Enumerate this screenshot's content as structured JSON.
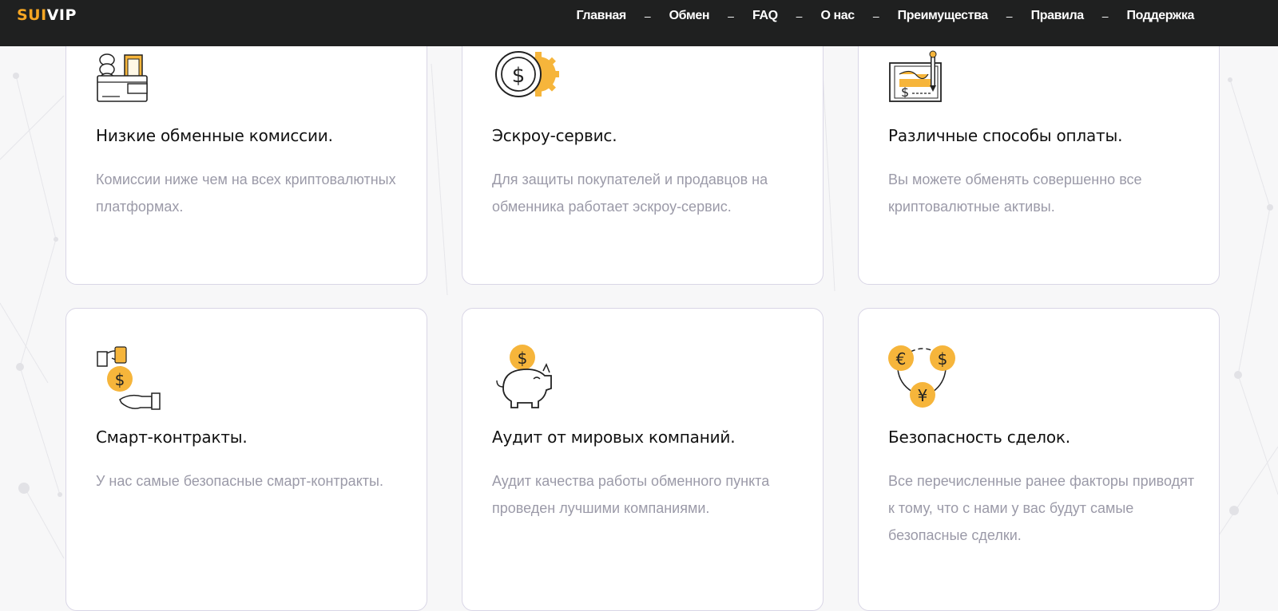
{
  "brand": {
    "logo_part1": "SUI",
    "logo_part2": "VIP",
    "accent_color": "#f6a623",
    "header_color": "#1f2020"
  },
  "nav": {
    "separator": "–",
    "items": [
      {
        "label": "Главная"
      },
      {
        "label": "Обмен"
      },
      {
        "label": "FAQ"
      },
      {
        "label": "О нас"
      },
      {
        "label": "Преимущества"
      },
      {
        "label": "Правила"
      },
      {
        "label": "Поддержка"
      }
    ]
  },
  "features": [
    {
      "icon": "wallet-coins-icon",
      "title": "Низкие обменные комиссии.",
      "text": "Комиссии ниже чем на всех криптовалютных платформах."
    },
    {
      "icon": "dollar-coin-gear-icon",
      "title": "Эскроу-сервис.",
      "text": "Для защиты покупателей и продавцов на обменника работает эскроу-сервис."
    },
    {
      "icon": "check-pen-icon",
      "title": "Различные способы оплаты.",
      "text": "Вы можете обменять совершенно все криптовалютные активы."
    },
    {
      "icon": "hand-coin-icon",
      "title": "Смарт-контракты.",
      "text": "У нас самые безопасные смарт-контракты."
    },
    {
      "icon": "piggy-bank-icon",
      "title": "Аудит от мировых компаний.",
      "text": "Аудит качества работы обменного пункта проведен лучшими компаниями."
    },
    {
      "icon": "currency-exchange-icon",
      "title": "Безопасность сделок.",
      "text": "Все перечисленные ранее факторы приводят к тому, что с нами у вас будут самые безопасные сделки."
    }
  ]
}
